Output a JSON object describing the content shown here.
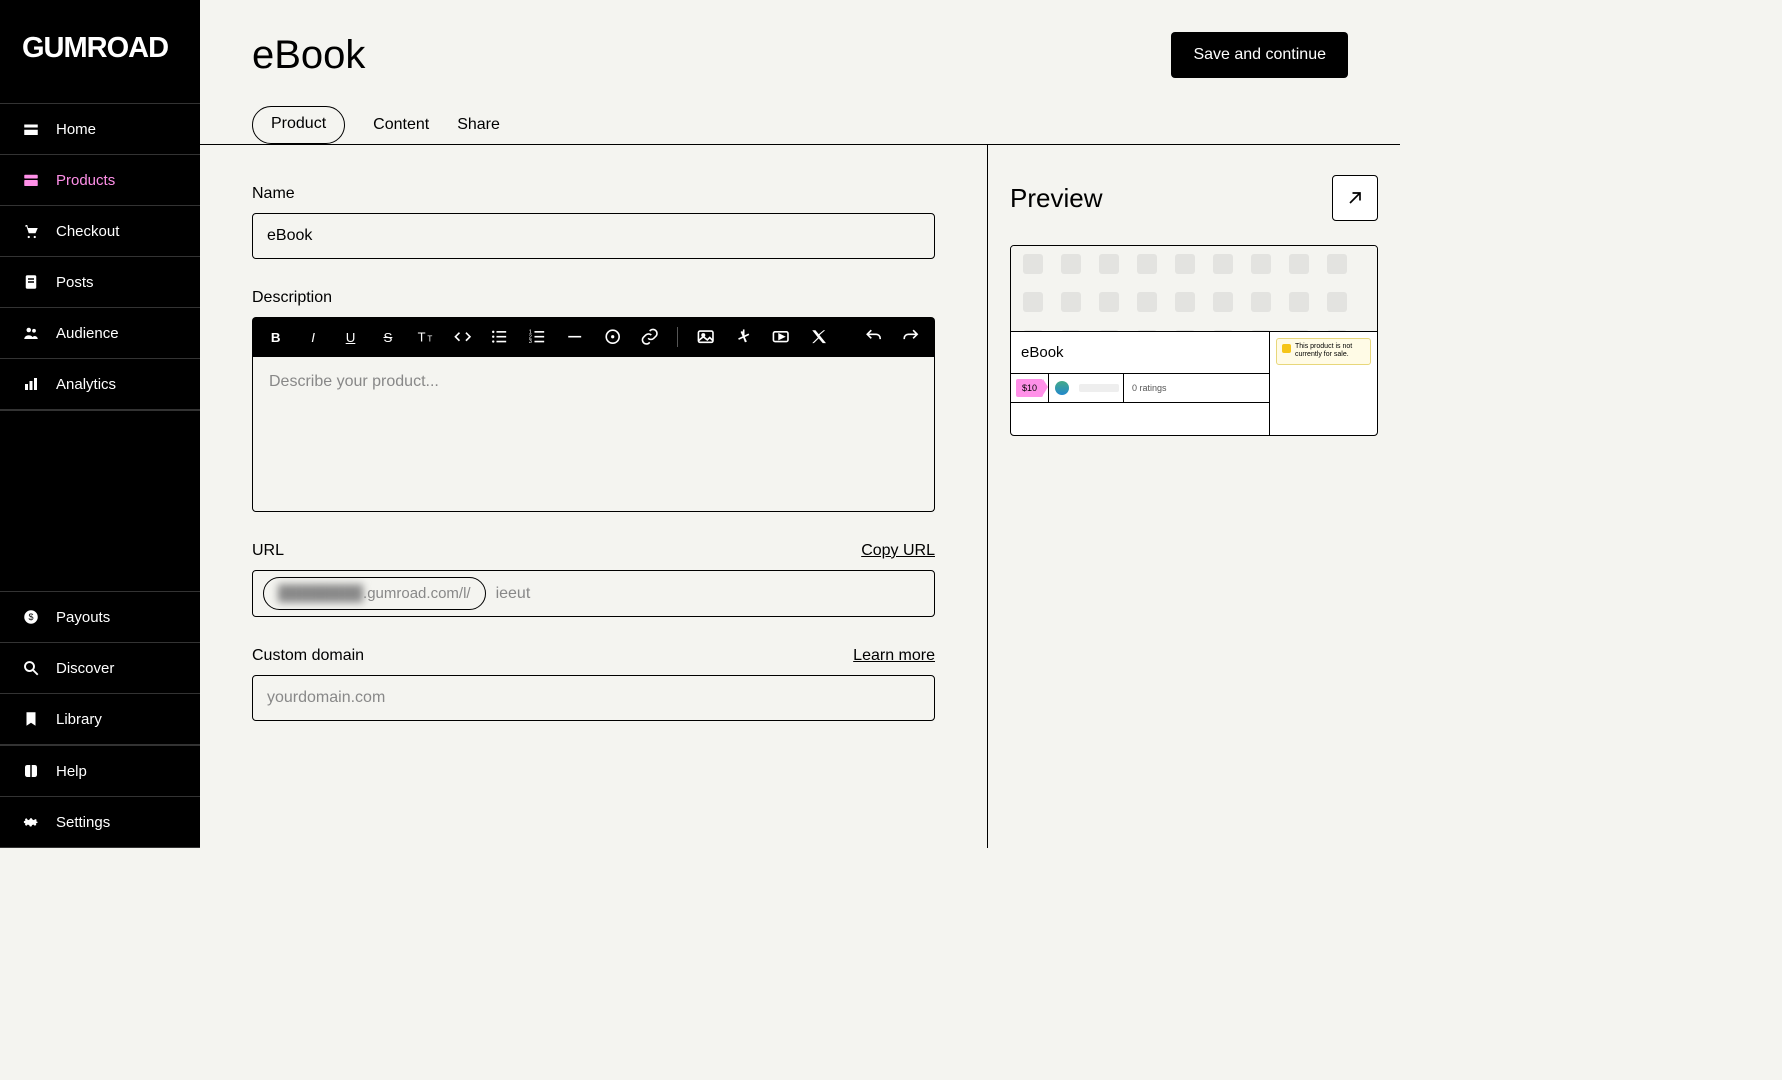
{
  "brand": "GUMROAD",
  "nav": {
    "home": "Home",
    "products": "Products",
    "checkout": "Checkout",
    "posts": "Posts",
    "audience": "Audience",
    "analytics": "Analytics",
    "payouts": "Payouts",
    "discover": "Discover",
    "library": "Library",
    "help": "Help",
    "settings": "Settings"
  },
  "header": {
    "title": "eBook",
    "save_label": "Save and continue"
  },
  "tabs": {
    "product": "Product",
    "content": "Content",
    "share": "Share"
  },
  "form": {
    "name_label": "Name",
    "name_value": "eBook",
    "description_label": "Description",
    "description_placeholder": "Describe your product...",
    "url_label": "URL",
    "copy_url": "Copy URL",
    "url_prefix_hidden": "████████",
    "url_prefix_visible": ".gumroad.com/l/",
    "url_slug": "ieeut",
    "custom_domain_label": "Custom domain",
    "learn_more": "Learn more",
    "custom_domain_placeholder": "yourdomain.com"
  },
  "preview": {
    "heading": "Preview",
    "product_name": "eBook",
    "price": "$10",
    "ratings": "0 ratings",
    "notice": "This product is not currently for sale."
  }
}
